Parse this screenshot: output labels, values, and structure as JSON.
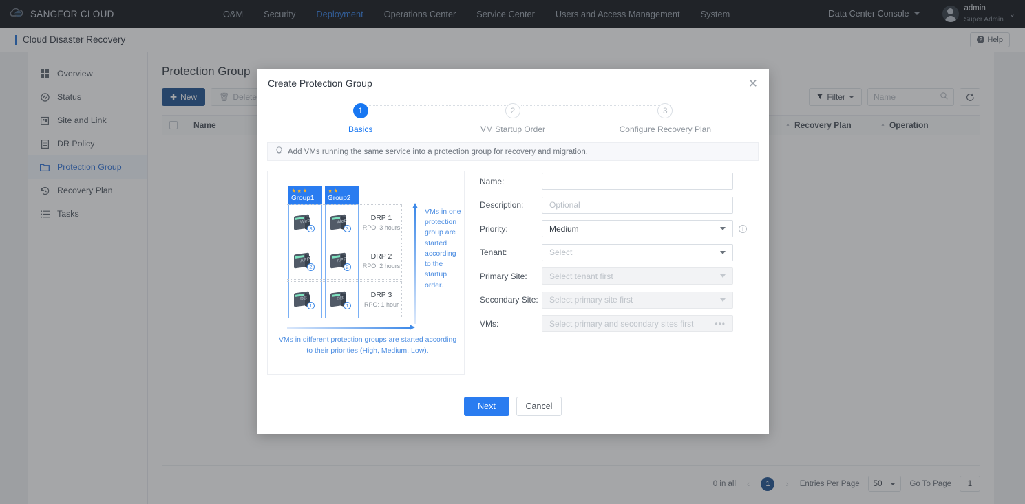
{
  "topnav": {
    "brand": "SANGFOR CLOUD",
    "items": [
      {
        "label": "O&M",
        "active": false
      },
      {
        "label": "Security",
        "active": false
      },
      {
        "label": "Deployment",
        "active": true
      },
      {
        "label": "Operations Center",
        "active": false
      },
      {
        "label": "Service Center",
        "active": false
      },
      {
        "label": "Users and Access Management",
        "active": false
      },
      {
        "label": "System",
        "active": false
      }
    ],
    "console": "Data Center Console",
    "user_name": "admin",
    "user_role": "Super Admin"
  },
  "page": {
    "title": "Cloud Disaster Recovery",
    "help_label": "Help"
  },
  "sidebar": {
    "items": [
      {
        "label": "Overview",
        "icon": "grid-icon"
      },
      {
        "label": "Status",
        "icon": "status-icon"
      },
      {
        "label": "Site and Link",
        "icon": "site-icon"
      },
      {
        "label": "DR Policy",
        "icon": "policy-icon"
      },
      {
        "label": "Protection Group",
        "icon": "folder-icon"
      },
      {
        "label": "Recovery Plan",
        "icon": "history-icon"
      },
      {
        "label": "Tasks",
        "icon": "list-icon"
      }
    ],
    "active_index": 4
  },
  "main": {
    "heading": "Protection Group",
    "new_label": "New",
    "delete_label": "Delete",
    "filter_label": "Filter",
    "search_placeholder": "Name",
    "columns": [
      "Name",
      "Recovery Plan",
      "Operation"
    ],
    "pagination": {
      "total": "0 in all",
      "current_page": "1",
      "entries_label": "Entries Per Page",
      "entries_value": "50",
      "goto_label": "Go To Page",
      "goto_value": "1"
    }
  },
  "modal": {
    "title": "Create Protection Group",
    "close": "✕",
    "steps": [
      {
        "num": "1",
        "label": "Basics"
      },
      {
        "num": "2",
        "label": "VM Startup Order"
      },
      {
        "num": "3",
        "label": "Configure Recovery Plan"
      }
    ],
    "tip": "Add VMs running the same service into a protection group for recovery and migration.",
    "illustration": {
      "groups": [
        {
          "name": "Group1",
          "stars": "★★★"
        },
        {
          "name": "Group2",
          "stars": "★★"
        }
      ],
      "rows": [
        {
          "vm": "Web",
          "order": "3",
          "drp": "DRP 1",
          "rpo": "RPO: 3 hours"
        },
        {
          "vm": "APP",
          "order": "2",
          "drp": "DRP 2",
          "rpo": "RPO: 2 hours"
        },
        {
          "vm": "DB",
          "order": "1",
          "drp": "DRP 3",
          "rpo": "RPO: 1 hour"
        }
      ],
      "vertical_text": "VMs in one protection group are started according to the startup order.",
      "horizontal_text": "VMs in different protection groups are started according to their priorities (High, Medium, Low)."
    },
    "fields": [
      {
        "label": "Name:",
        "value": "",
        "placeholder": "",
        "type": "text",
        "disabled": false,
        "info": false
      },
      {
        "label": "Description:",
        "value": "",
        "placeholder": "Optional",
        "type": "text",
        "disabled": false,
        "info": false
      },
      {
        "label": "Priority:",
        "value": "Medium",
        "placeholder": "",
        "type": "select",
        "disabled": false,
        "info": true
      },
      {
        "label": "Tenant:",
        "value": "",
        "placeholder": "Select",
        "type": "select",
        "disabled": false,
        "info": false
      },
      {
        "label": "Primary Site:",
        "value": "",
        "placeholder": "Select tenant first",
        "type": "select",
        "disabled": true,
        "info": false
      },
      {
        "label": "Secondary Site:",
        "value": "",
        "placeholder": "Select primary site first",
        "type": "select",
        "disabled": true,
        "info": false
      },
      {
        "label": "VMs:",
        "value": "",
        "placeholder": "Select primary and secondary sites first",
        "type": "picker",
        "disabled": true,
        "info": false
      }
    ],
    "next_label": "Next",
    "cancel_label": "Cancel"
  },
  "colors": {
    "nav_bg": "#0d1117",
    "accent": "#2a7cf0",
    "primary_dark": "#1a4f8f",
    "star": "#f8b323"
  }
}
